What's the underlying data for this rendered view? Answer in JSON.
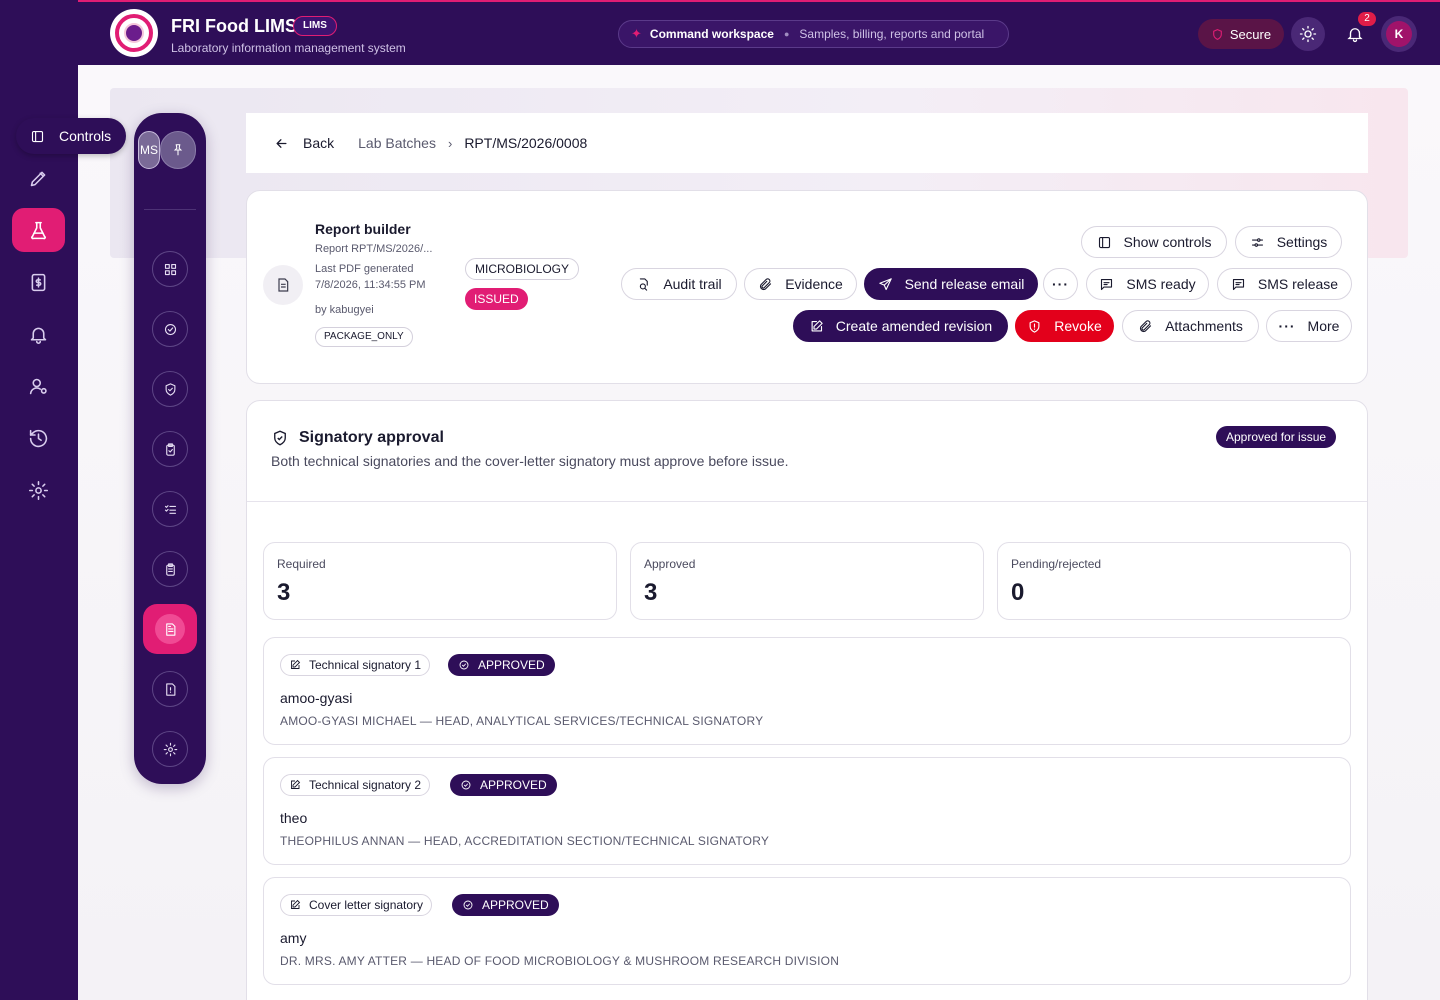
{
  "app": {
    "title": "FRI Food LIMS",
    "chip": "LIMS",
    "subtitle": "Laboratory information management system"
  },
  "command": {
    "label": "Command workspace",
    "sub": "Samples, billing, reports and portal"
  },
  "topbar": {
    "secure_label": "Secure",
    "notifications_count": "2",
    "avatar_initial": "K"
  },
  "controls_tip": "Controls",
  "dock": {
    "badge": "MS"
  },
  "breadcrumb": {
    "back": "Back",
    "parent": "Lab Batches",
    "current": "RPT/MS/2026/0008"
  },
  "report_builder": {
    "title": "Report builder",
    "report": "Report RPT/MS/2026/...",
    "last_pdf_label": "Last PDF generated",
    "last_pdf_time": "7/8/2026, 11:34:55 PM",
    "by": "by kabugyei",
    "package": "PACKAGE_ONLY",
    "discipline": "MICROBIOLOGY",
    "status": "ISSUED"
  },
  "actions": {
    "show_controls": "Show controls",
    "settings": "Settings",
    "audit_trail": "Audit trail",
    "evidence": "Evidence",
    "send_release_email": "Send release email",
    "sms_ready": "SMS ready",
    "sms_release": "SMS release",
    "create_amended_revision": "Create amended revision",
    "revoke": "Revoke",
    "attachments": "Attachments",
    "more": "More"
  },
  "signatory": {
    "title": "Signatory approval",
    "subtitle": "Both technical signatories and the cover-letter signatory must approve before issue.",
    "status_chip": "Approved for issue",
    "stats": [
      {
        "label": "Required",
        "value": "3"
      },
      {
        "label": "Approved",
        "value": "3"
      },
      {
        "label": "Pending/rejected",
        "value": "0"
      }
    ],
    "rows": [
      {
        "role": "Technical signatory 1",
        "status": "APPROVED",
        "username": "amoo-gyasi",
        "full": "AMOO-GYASI MICHAEL — HEAD, ANALYTICAL SERVICES/TECHNICAL SIGNATORY"
      },
      {
        "role": "Technical signatory 2",
        "status": "APPROVED",
        "username": "theo",
        "full": "THEOPHILUS ANNAN — HEAD, ACCREDITATION SECTION/TECHNICAL SIGNATORY"
      },
      {
        "role": "Cover letter signatory",
        "status": "APPROVED",
        "username": "amy",
        "full": "DR. MRS. AMY ATTER — HEAD OF FOOD MICROBIOLOGY & MUSHROOM RESEARCH DIVISION"
      }
    ]
  },
  "colors": {
    "brand_dark": "#2e0e58",
    "accent": "#e11d74",
    "danger": "#e3001b"
  }
}
